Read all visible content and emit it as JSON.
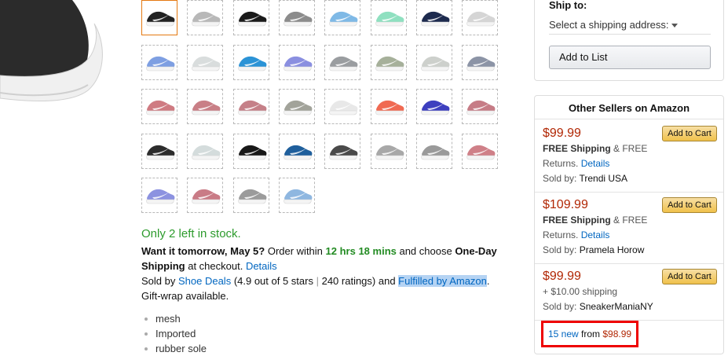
{
  "swatch_colors": [
    [
      "#222222",
      "#b8b8b8",
      "#1a1a1a",
      "#8c8c8c",
      "#7fb9e6",
      "#8fe0c0",
      "#1d2a4e",
      "#d5d5d5"
    ],
    [
      "#7e9fe2",
      "#d9dddd",
      "#2b93d6",
      "#8a8fe0",
      "#9a9da0",
      "#a6b09a",
      "#cdd0cc",
      "#8c94a6"
    ],
    [
      "#cf7b82",
      "#c97f86",
      "#c58088",
      "#a2a39a",
      "#e8e8e8",
      "#f06a52",
      "#3d3fbf",
      "#c67c86"
    ],
    [
      "#2c2c2c",
      "#d4dcdc",
      "#181818",
      "#1f5f9c",
      "#4a4a4a",
      "#a8a8a8",
      "#9a9a9a",
      "#cf8088"
    ],
    [
      "#8c92e0",
      "#c97b86",
      "#9b9b9b",
      "#8fb7e0"
    ]
  ],
  "stock": {
    "text": "Only 2 left in stock."
  },
  "shipping": {
    "want_label": "Want it tomorrow, May 5?",
    "order_within": " Order within ",
    "countdown": "12 hrs 18 mins",
    "and_choose": " and choose ",
    "one_day": "One-Day Shipping",
    "at_checkout": " at checkout. ",
    "details": "Details",
    "sold_by_prefix": "Sold by ",
    "seller": "Shoe Deals",
    "rating": " (4.9 out of 5 stars ",
    "sep": "|",
    "ratings_count": " 240 ratings) and ",
    "fulfilled": "Fulfilled by Amazon",
    "giftwrap": ". Gift-wrap available."
  },
  "bullets": [
    "mesh",
    "Imported",
    "rubber sole"
  ],
  "ship_panel": {
    "title": "Ship to:",
    "select_value": "Select a shipping address:",
    "add_to_list": "Add to List"
  },
  "sellers": {
    "title": "Other Sellers on Amazon",
    "offers": [
      {
        "price": "$99.99",
        "ship_bold": "FREE Shipping",
        "ship_rest": " & FREE",
        "line2": "Returns. ",
        "details": "Details",
        "sold_by": "Sold by: ",
        "seller": "Trendi USA",
        "button": "Add to Cart"
      },
      {
        "price": "$109.99",
        "ship_bold": "FREE Shipping",
        "ship_rest": " & FREE",
        "line2": "Returns. ",
        "details": "Details",
        "sold_by": "Sold by: ",
        "seller": "Pramela Horow",
        "button": "Add to Cart"
      },
      {
        "price": "$99.99",
        "ship_plain": "+ $10.00 shipping",
        "sold_by": "Sold by: ",
        "seller": "SneakerManiaNY",
        "button": "Add to Cart"
      }
    ],
    "new_count": "15 new",
    "from": " from ",
    "from_price": "$98.99"
  }
}
